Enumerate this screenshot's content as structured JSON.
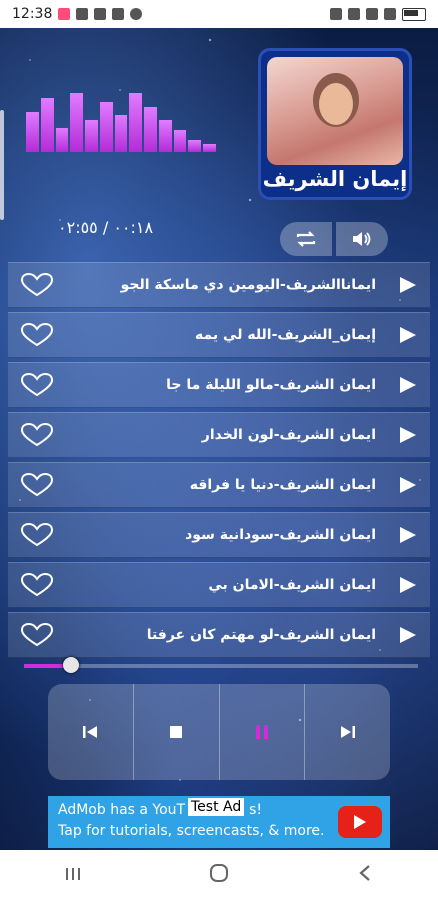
{
  "status_bar": {
    "time": "12:38"
  },
  "equalizer": {
    "levels": [
      0.62,
      0.84,
      0.38,
      0.92,
      0.5,
      0.78,
      0.58,
      0.92,
      0.7,
      0.5,
      0.34,
      0.18,
      0.12
    ]
  },
  "artist": {
    "name": "إيمان الشريف"
  },
  "player": {
    "time_display": "٠٠:١٨ / ٠٢:٥٥",
    "progress": 0.11
  },
  "tracks": [
    {
      "title": "ايماناالشريف-اليومين دي ماسكة الجو"
    },
    {
      "title": "إيمان_الشريف-الله لي يمه"
    },
    {
      "title": "ايمان الشريف-مالو الليلة ما جا"
    },
    {
      "title": "ايمان الشريف-لون الخدار"
    },
    {
      "title": "ايمان الشريف-دنيا يا فراقه"
    },
    {
      "title": "ايمان الشريف-سودانية سود"
    },
    {
      "title": "ايمان الشريف-الامان بي"
    },
    {
      "title": "ايمان الشريف-لو مهتم كان عرفتا"
    }
  ],
  "ad": {
    "line1": "AdMob has a YouT",
    "line1_end": "s!",
    "badge": "Test Ad",
    "line2": "Tap for tutorials, screencasts, & more."
  },
  "colors": {
    "accent": "#d22bd8",
    "ad_bg": "#2fa3e6"
  },
  "icons": [
    "repeat-icon",
    "volume-icon",
    "heart-icon",
    "play-icon",
    "previous-icon",
    "stop-icon",
    "pause-icon",
    "next-icon",
    "youtube-icon"
  ]
}
